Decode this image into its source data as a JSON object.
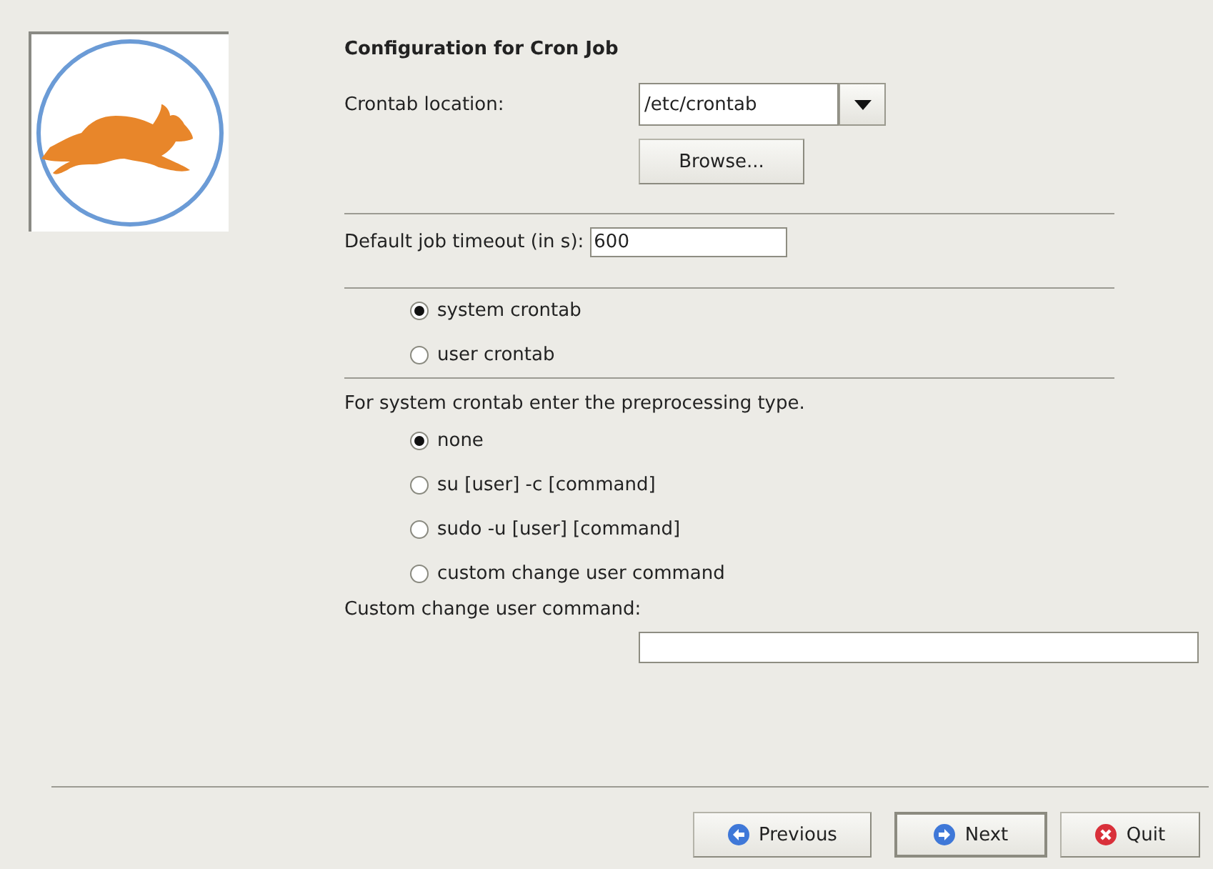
{
  "title": "Configuration for Cron Job",
  "crontab_location": {
    "label": "Crontab location:",
    "value": "/etc/crontab"
  },
  "browse_button": "Browse...",
  "timeout": {
    "label": "Default job timeout (in s):",
    "value": "600"
  },
  "crontab_type": [
    {
      "label": "system crontab",
      "selected": true
    },
    {
      "label": "user crontab",
      "selected": false
    }
  ],
  "preprocessing": {
    "prompt": "For system crontab enter the preprocessing type.",
    "options": [
      {
        "label": "none",
        "selected": true
      },
      {
        "label": "su [user] -c [command]",
        "selected": false
      },
      {
        "label": "sudo -u [user] [command]",
        "selected": false
      },
      {
        "label": "custom change user command",
        "selected": false
      }
    ]
  },
  "custom_command": {
    "label": "Custom change user command:"
  },
  "buttons": [
    {
      "kind": "previous",
      "label": "Previous"
    },
    {
      "kind": "next",
      "label": "Next"
    },
    {
      "kind": "quit",
      "label": "Quit"
    }
  ]
}
